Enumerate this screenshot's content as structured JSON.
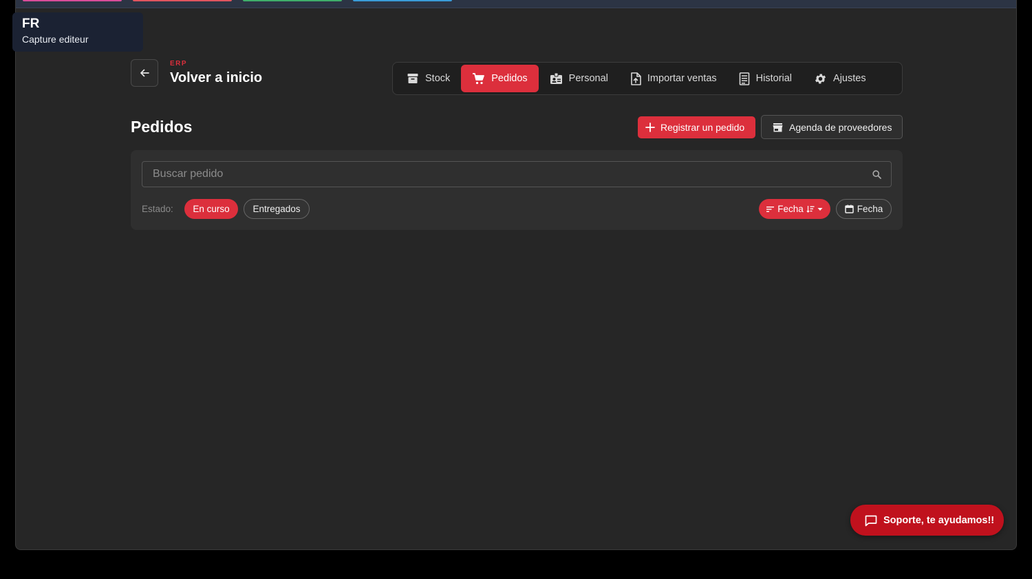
{
  "badge": {
    "code": "FR",
    "subtitle": "Capture editeur"
  },
  "header": {
    "section_label": "ERP",
    "home_title": "Volver a inicio"
  },
  "nav": {
    "items": [
      {
        "label": "Stock",
        "icon": "archive-icon",
        "active": false
      },
      {
        "label": "Pedidos",
        "icon": "cart-icon",
        "active": true
      },
      {
        "label": "Personal",
        "icon": "badge-icon",
        "active": false
      },
      {
        "label": "Importar ventas",
        "icon": "file-upload-icon",
        "active": false
      },
      {
        "label": "Historial",
        "icon": "receipt-icon",
        "active": false
      },
      {
        "label": "Ajustes",
        "icon": "gear-icon",
        "active": false
      }
    ]
  },
  "page": {
    "title": "Pedidos",
    "register_button": "Registrar un pedido",
    "suppliers_button": "Agenda de proveedores"
  },
  "filters": {
    "search_placeholder": "Buscar pedido",
    "estado_label": "Estado:",
    "chip_in_progress": "En curso",
    "chip_delivered": "Entregados",
    "sort_chip": "Fecha",
    "date_chip": "Fecha"
  },
  "support": {
    "label": "Soporte, te ayudamos!!"
  },
  "colors": {
    "accent": "#dc2f3c",
    "support": "#c0111d",
    "background": "#262626"
  }
}
